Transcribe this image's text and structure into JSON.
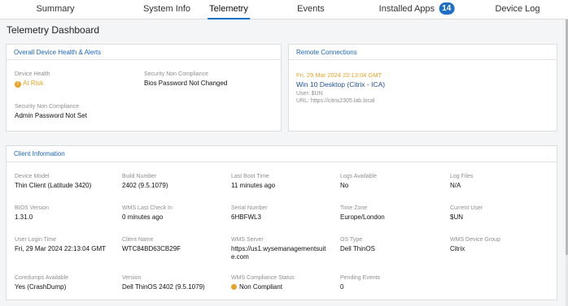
{
  "tabs": [
    {
      "label": "Summary"
    },
    {
      "label": "System Info"
    },
    {
      "label": "Telemetry"
    },
    {
      "label": "Events"
    },
    {
      "label": "Installed Apps",
      "badge": "14"
    },
    {
      "label": "Device Log"
    }
  ],
  "page": {
    "title": "Telemetry Dashboard"
  },
  "health": {
    "title": "Overall Device Health & Alerts",
    "device_health_label": "Device Health",
    "device_health_value": "At Risk",
    "sec1_label": "Security Non Compliance",
    "sec1_value": "Bios Password Not Changed",
    "sec2_label": "Security Non Compliance",
    "sec2_value": "Admin Password Not Set"
  },
  "remote": {
    "title": "Remote Connections",
    "timestamp": "Fri, 29 Mar 2024 22:13:04 GMT",
    "session": "Win 10 Desktop (Citrix - ICA)",
    "user": "User: $UN",
    "url": "URL: https://citrix2305.lab.local"
  },
  "client": {
    "title": "Client Information",
    "fields": {
      "device_model": {
        "label": "Device Model",
        "value": "Thin Client (Latitude 3420)"
      },
      "build_number": {
        "label": "Build Number",
        "value": "2402 (9.5.1079)"
      },
      "last_boot": {
        "label": "Last Boot Time",
        "value": "11 minutes ago"
      },
      "logs_available": {
        "label": "Logs Available",
        "value": "No"
      },
      "log_files": {
        "label": "Log Files",
        "value": "N/A"
      },
      "bios_version": {
        "label": "BIOS Version",
        "value": "1.31.0"
      },
      "wms_checkin": {
        "label": "WMS Last Check In",
        "value": "0 minutes ago"
      },
      "serial": {
        "label": "Serial Number",
        "value": "6HBFWL3"
      },
      "timezone": {
        "label": "Time Zone",
        "value": "Europe/London"
      },
      "current_user": {
        "label": "Current User",
        "value": "$UN"
      },
      "login_time": {
        "label": "User Login Time",
        "value": "Fri, 29 Mar 2024 22:13:04 GMT"
      },
      "client_name": {
        "label": "Client Name",
        "value": "WTC84BD63CB29F"
      },
      "wms_server": {
        "label": "WMS Server",
        "value": "https://us1.wysemanagementsuite.com"
      },
      "os_type": {
        "label": "OS Type",
        "value": "Dell ThinOS"
      },
      "wms_group": {
        "label": "WMS Device Group",
        "value": "Citrix"
      },
      "coredumps": {
        "label": "Coredumps Available",
        "value": "Yes (CrashDump)"
      },
      "version": {
        "label": "Version",
        "value": "Dell ThinOS 2402 (9.5.1079)"
      },
      "compliance": {
        "label": "WMS Compliance Status",
        "value": "Non Compliant"
      },
      "pending_events": {
        "label": "Pending Events",
        "value": "0"
      }
    }
  },
  "colors": {
    "accent": "#1a65c0",
    "warning": "#e7a326",
    "badge": "#1f6fc8"
  }
}
